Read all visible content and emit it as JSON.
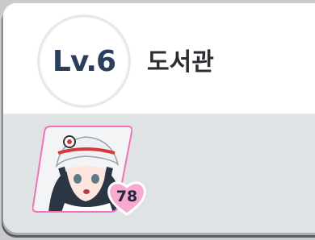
{
  "building": {
    "level_label": "Lv.6",
    "name": "도서관"
  },
  "student": {
    "affection": "78",
    "colors": {
      "frame": "#ef72b9",
      "heart": "#f7a9cf"
    }
  },
  "icons": [
    "student-portrait",
    "heart-icon"
  ]
}
